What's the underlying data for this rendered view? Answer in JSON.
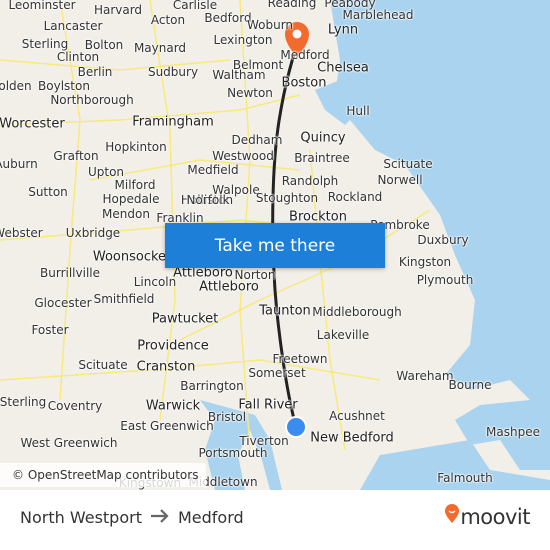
{
  "map": {
    "colors": {
      "land": "#f2efe9",
      "water": "#a9d3ee",
      "route": "#222222",
      "origin": "#3b8cf0",
      "destination": "#f26a2e",
      "roads": "#f7e97a"
    },
    "labels": [
      "Leominster",
      "Harvard",
      "Acton",
      "Carlisle",
      "Bedford",
      "Woburn",
      "Reading",
      "Peabody",
      "Marblehead",
      "Lancaster",
      "Lexington",
      "Lynn",
      "Sterling",
      "Bolton",
      "Maynard",
      "Medford",
      "Chelsea",
      "Clinton",
      "Belmont",
      "Berlin",
      "Sudbury",
      "Waltham",
      "Boston",
      "Boylston",
      "olden",
      "Northborough",
      "Newton",
      "Hull",
      "Worcester",
      "Framingham",
      "Quincy",
      "Dedham",
      "Hopkinton",
      "Westwood",
      "Braintree",
      "Scituate",
      "Auburn",
      "Grafton",
      "Upton",
      "Medfield",
      "Randolph",
      "Norwell",
      "Milford",
      "Walpole",
      "Holliston",
      "Sutton",
      "Hopedale",
      "Norfolk",
      "Stoughton",
      "Rockland",
      "Mendon",
      "Franklin",
      "Brockton",
      "Pembroke",
      "Duxbury",
      "Webster",
      "Uxbridge",
      "Woonsocket",
      "Kingston",
      "Burrillville",
      "Attleboro",
      "Norton",
      "Lincoln",
      "Attleboro",
      "Plymouth",
      "Glocester",
      "Smithfield",
      "Taunton",
      "Middleborough",
      "Pawtucket",
      "Lakeville",
      "Foster",
      "Providence",
      "Freetown",
      "Scituate",
      "Cranston",
      "Somerset",
      "Wareham",
      "Barrington",
      "Bourne",
      "Sterling",
      "Coventry",
      "Warwick",
      "Fall River",
      "Acushnet",
      "East Greenwich",
      "Bristol",
      "Mashpee",
      "West Greenwich",
      "New Bedford",
      "Tiverton",
      "Portsmouth",
      "Kingstown",
      "Middletown",
      "Falmouth"
    ],
    "cta_label": "Take me there",
    "attribution": "© OpenStreetMap contributors"
  },
  "footer": {
    "origin": "North Westport",
    "destination": "Medford",
    "arrow_icon": "arrow-right-icon",
    "brand": "moovit"
  }
}
